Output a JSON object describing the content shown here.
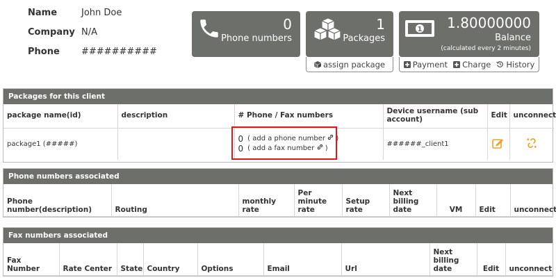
{
  "client": {
    "name_label": "Name",
    "name_value": "John Doe",
    "company_label": "Company",
    "company_value": "N/A",
    "phone_label": "Phone",
    "phone_value": "##########"
  },
  "cards": {
    "phone_numbers": {
      "value": "0",
      "label": "Phone numbers"
    },
    "packages": {
      "value": "1",
      "label": "Packages",
      "action": "assign package"
    },
    "balance": {
      "value": "1.80000000",
      "label": "Balance",
      "note": "(calculated every 2 minutes)",
      "actions": {
        "payment": "Payment",
        "charge": "Charge",
        "history": "History"
      }
    }
  },
  "packages_panel": {
    "title": "Packages for this client",
    "columns": [
      "package name(id)",
      "description",
      "# Phone / Fax numbers",
      "Device username (sub account)",
      "Edit",
      "unconnect"
    ],
    "rows": [
      {
        "name": "package1 (#####)",
        "description": "",
        "phone_count": "0",
        "add_phone": "( add a phone number",
        "fax_count": "0",
        "add_fax": "( add a fax number",
        "close_paren": ")",
        "device_username": "######_client1"
      }
    ]
  },
  "phone_panel": {
    "title": "Phone numbers associated",
    "columns": [
      "Phone number(description)",
      "Routing",
      "monthly rate",
      "Per minute rate",
      "Setup rate",
      "Next billing date",
      "VM",
      "Edit",
      "unconnect"
    ]
  },
  "fax_panel": {
    "title": "Fax numbers associated",
    "columns": [
      "Fax Number",
      "Rate Center",
      "State",
      "Country",
      "Options",
      "Email",
      "Url",
      "Next billing date",
      "Edit",
      "unconnect"
    ]
  },
  "colors": {
    "header_bg": "#6c6f6a",
    "edit_icon": "#f0a020",
    "highlight": "#e0161b"
  }
}
